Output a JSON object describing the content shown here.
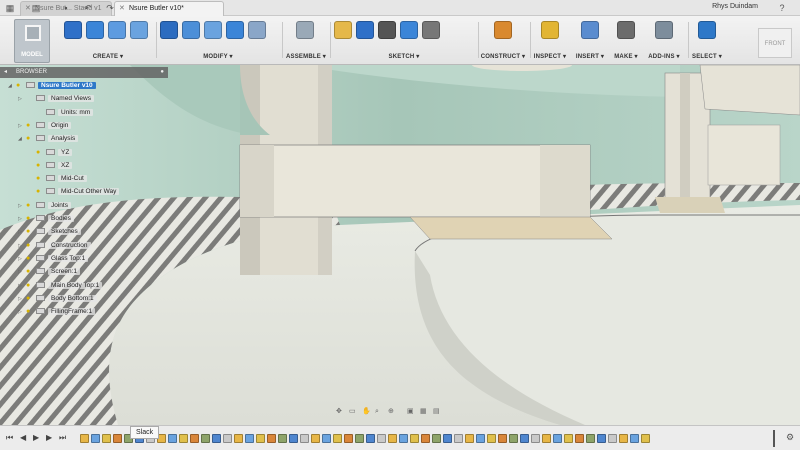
{
  "window": {
    "tabs": [
      {
        "label": "Nsure But... Stand v1",
        "active": false
      },
      {
        "label": "Nsure Butler v10*",
        "active": true
      }
    ],
    "user": "Rhys Duindam",
    "icons": [
      "file-icon",
      "save-icon",
      "undo-icon",
      "redo-icon",
      "help-icon"
    ]
  },
  "toolbar": {
    "workspace": "MODEL",
    "groups": [
      {
        "label": "CREATE ▾",
        "colors": [
          "#2f70c8",
          "#3b85d8",
          "#5d9be0",
          "#6aa3df"
        ]
      },
      {
        "label": "MODIFY ▾",
        "colors": [
          "#2c6cc0",
          "#4c8fd8",
          "#6aa3df",
          "#3b85d8",
          "#8aa6c8"
        ]
      },
      {
        "label": "ASSEMBLE ▾",
        "colors": [
          "#9aa9b7"
        ]
      },
      {
        "label": "SKETCH ▾",
        "colors": [
          "#e5b84a",
          "#2f70c8",
          "#555555",
          "#3b85d8",
          "#777777"
        ]
      },
      {
        "label": "CONSTRUCT ▾",
        "colors": [
          "#d9892f"
        ]
      },
      {
        "label": "INSPECT ▾",
        "colors": [
          "#e2b533"
        ]
      },
      {
        "label": "INSERT ▾",
        "colors": [
          "#5a8ccf"
        ]
      },
      {
        "label": "MAKE ▾",
        "colors": [
          "#6c6c6c"
        ]
      },
      {
        "label": "ADD-INS ▾",
        "colors": [
          "#7d8d9c"
        ]
      },
      {
        "label": "SELECT ▾",
        "colors": [
          "#2e78c8"
        ]
      }
    ],
    "view_cube_label": "FRONT"
  },
  "browser": {
    "title": "BROWSER",
    "items": [
      {
        "label": "Nsure Butler v10",
        "level": 0,
        "root": true
      },
      {
        "label": "Named Views",
        "level": 1
      },
      {
        "label": "Units: mm",
        "level": 2
      },
      {
        "label": "Origin",
        "level": 1
      },
      {
        "label": "Analysis",
        "level": 1
      },
      {
        "label": "YZ",
        "level": 2
      },
      {
        "label": "XZ",
        "level": 2
      },
      {
        "label": "Mid-Cut",
        "level": 2
      },
      {
        "label": "Mid-Cut Other Way",
        "level": 2
      },
      {
        "label": "Joints",
        "level": 1
      },
      {
        "label": "Bodies",
        "level": 1
      },
      {
        "label": "Sketches",
        "level": 1
      },
      {
        "label": "Construction",
        "level": 1
      },
      {
        "label": "Glass Top:1",
        "level": 1
      },
      {
        "label": "Screen:1",
        "level": 1
      },
      {
        "label": "Main Body Top:1",
        "level": 1
      },
      {
        "label": "Body Bottom:1",
        "level": 1
      },
      {
        "label": "FillingFrame:1",
        "level": 1
      }
    ]
  },
  "timeline": {
    "tooltip": "Slack"
  },
  "colors": {
    "viewport_mint": "#b7d3c6",
    "surface": "#e3e5dc",
    "selection_blue": "#2e78c8"
  }
}
